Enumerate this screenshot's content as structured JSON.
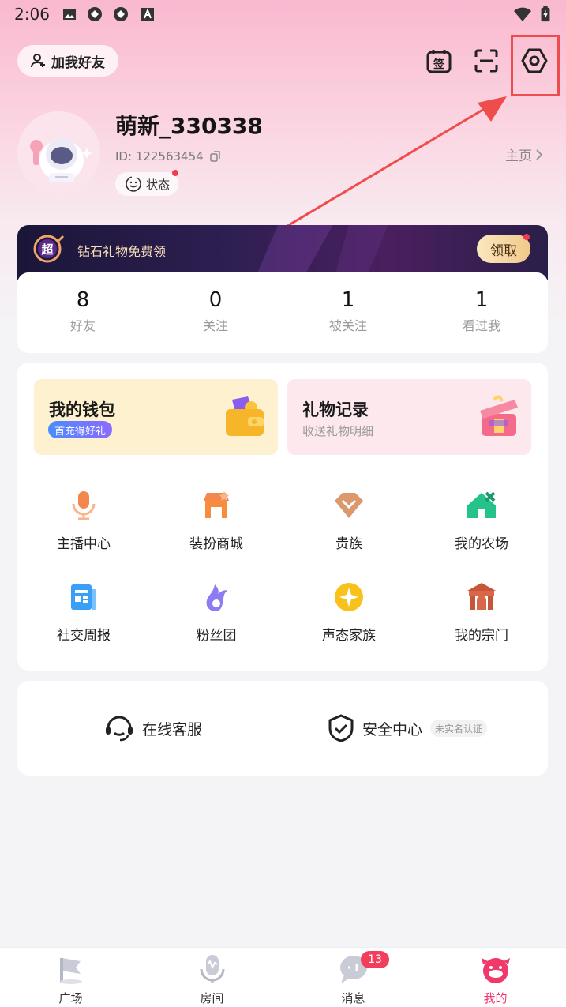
{
  "status_bar": {
    "time": "2:06"
  },
  "header": {
    "add_friend_label": "加我好友"
  },
  "profile": {
    "username": "萌新_330338",
    "user_id": "ID: 122563454",
    "status_label": "状态",
    "homepage_label": "主页"
  },
  "banner": {
    "text": "钻石礼物免费领",
    "claim_label": "领取",
    "logo_glyph": "超"
  },
  "stats": [
    {
      "value": "8",
      "label": "好友"
    },
    {
      "value": "0",
      "label": "关注"
    },
    {
      "value": "1",
      "label": "被关注"
    },
    {
      "value": "1",
      "label": "看过我"
    }
  ],
  "wallet": {
    "title": "我的钱包",
    "badge": "首充得好礼"
  },
  "gift_record": {
    "title": "礼物记录",
    "subtitle": "收送礼物明细"
  },
  "features": [
    {
      "label": "主播中心",
      "icon": "microphone-icon"
    },
    {
      "label": "装扮商城",
      "icon": "store-icon"
    },
    {
      "label": "贵族",
      "icon": "diamond-icon"
    },
    {
      "label": "我的农场",
      "icon": "farm-house-icon"
    },
    {
      "label": "社交周报",
      "icon": "newspaper-icon"
    },
    {
      "label": "粉丝团",
      "icon": "flame-icon"
    },
    {
      "label": "声态家族",
      "icon": "star-badge-icon"
    },
    {
      "label": "我的宗门",
      "icon": "temple-icon"
    }
  ],
  "service": {
    "support_label": "在线客服",
    "security_label": "安全中心",
    "verify_label": "未实名认证"
  },
  "nav": [
    {
      "label": "广场",
      "icon": "flag-icon"
    },
    {
      "label": "房间",
      "icon": "mic-room-icon"
    },
    {
      "label": "消息",
      "icon": "chat-bubble-icon"
    },
    {
      "label": "我的",
      "icon": "profile-mascot-icon"
    }
  ],
  "messages_badge": "13",
  "colors": {
    "accent": "#f23d5c",
    "highlight": "#ee4d4d",
    "active_tab": "#f0396a"
  }
}
